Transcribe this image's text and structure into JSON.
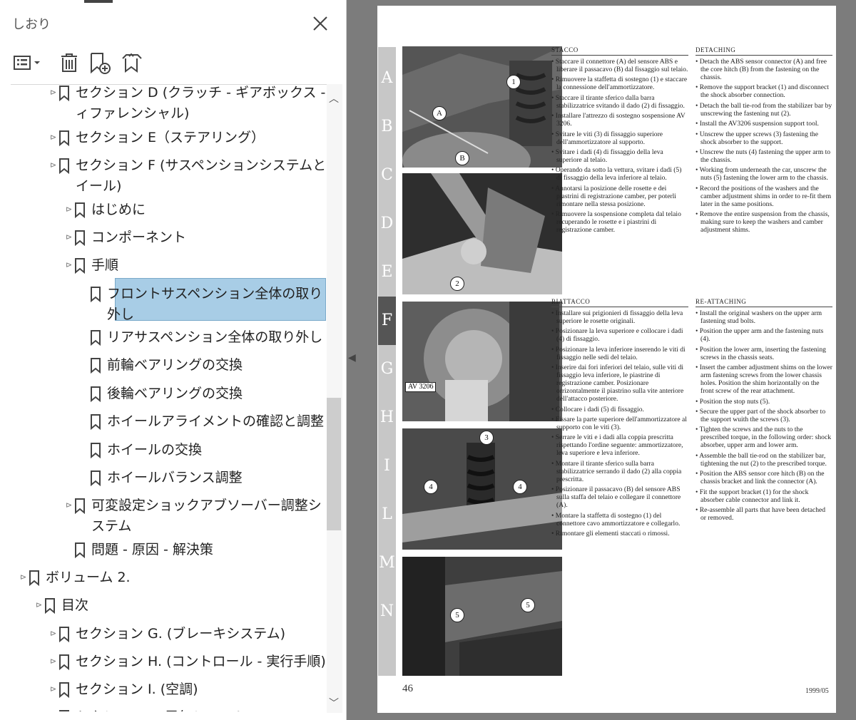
{
  "panel": {
    "title": "しおり",
    "toolbar": {
      "options": "options-icon",
      "delete": "trash-icon",
      "add": "add-bookmark-icon",
      "expand": "expand-bookmark-icon"
    }
  },
  "bookmarks": [
    {
      "label": "セクション D (クラッチ - ギアボックス - デ",
      "label2": "ィファレンシャル)"
    },
    {
      "label": "セクション E（ステアリング）"
    },
    {
      "label": "セクション F (サスペンションシステムとホ",
      "label2": "イール)"
    },
    {
      "label": "はじめに"
    },
    {
      "label": "コンポーネント"
    },
    {
      "label": "手順"
    },
    {
      "label": "フロントサスペンション全体の取り",
      "label2": "外し"
    },
    {
      "label": "リアサスペンション全体の取り外し"
    },
    {
      "label": "前輪ベアリングの交換"
    },
    {
      "label": "後輪ベアリングの交換"
    },
    {
      "label": "ホイールアライメントの確認と調整"
    },
    {
      "label": "ホイールの交換"
    },
    {
      "label": "ホイールバランス調整"
    },
    {
      "label": "可変設定ショックアブソーバー調整シ",
      "label2": "ステム"
    },
    {
      "label": "問題 - 原因 - 解決策"
    },
    {
      "label": "ボリューム 2."
    },
    {
      "label": "目次"
    },
    {
      "label": "セクション G. (ブレーキシステム)"
    },
    {
      "label": "セクション H. (コントロール - 実行手順)"
    },
    {
      "label": "セクション I. (空調)"
    },
    {
      "label": "セクション L (電気システム)"
    }
  ],
  "doc": {
    "tabs": [
      "A",
      "B",
      "C",
      "D",
      "E",
      "F",
      "G",
      "H",
      "I",
      "L",
      "M",
      "N"
    ],
    "active_tab": "F",
    "page_number": "46",
    "date": "1999/05",
    "fig_caption": "AV 3206",
    "it_detach_title": "Stacco",
    "it_detach": [
      "Staccare il connettore (A) del sensore ABS e liberare il passacavo (B) dal fissaggio sul telaio.",
      "Rimuovere la staffetta di sostegno (1) e staccare la connessione dell'ammortizzatore.",
      "Staccare il tirante sferico dalla barra stabilizzatrice svitando il dado (2) di fissaggio.",
      "Installare l'attrezzo di sostegno sospensione AV 3206.",
      "Svitare le viti (3) di fissaggio superiore dell'ammortizzatore al supporto.",
      "Svitare i dadi (4) di fissaggio della leva superiore al telaio.",
      "Operando da sotto la vettura, svitare i dadi (5) di fissaggio della leva inferiore al telaio.",
      "Annotarsi la posizione delle rosette e dei piastrini di registrazione camber, per poterli rimontare nella stessa posizione.",
      "Rimuovere la sospensione completa dal telaio recuperando le rosette e i piastrini di registrazione camber."
    ],
    "en_detach_title": "Detaching",
    "en_detach": [
      "Detach the ABS sensor connector (A) and free the core hitch (B) from the fastening on the chassis.",
      "Remove the support bracket (1) and disconnect the shock absorber connection.",
      "Detach the ball tie-rod from the stabilizer bar by unscrewing the fastening nut (2).",
      "Install the AV3206 suspension support tool.",
      "Unscrew the upper screws (3) fastening the shock absorber to the support.",
      "Unscrew the nuts (4) fastening the upper arm to the chassis.",
      "Working from underneath the car, unscrew the nuts (5) fastening the lower arm to the chassis.",
      "Record the positions of the washers and the camber adjustment shims in order to re-fit them later in the same positions.",
      "Remove the entire suspension from the chassis, making sure to keep the washers and camber adjustment shims."
    ],
    "it_attach_title": "Riattacco",
    "it_attach": [
      "Installare sui prigionieri di fissaggio della leva superiore le rosette originali.",
      "Posizionare la leva superiore e collocare i dadi (4) di fissaggio.",
      "Posizionare la leva inferiore inserendo le viti di fissaggio nelle sedi del telaio.",
      "Inserire dai fori inferiori del telaio, sulle viti di fissaggio leva inferiore, le piastrine di registrazione camber. Posizionare orrizontalmente il piastrino sulla vite anteriore dell'attacco posteriore.",
      "Collocare i dadi (5) di fissaggio.",
      "Fissare la parte superiore dell'ammortizzatore al supporto con le viti (3).",
      "Serrare le viti e i dadi alla coppia prescritta rispettando l'ordine seguente: ammortizzatore, leva superiore e leva inferiore.",
      "Montare il tirante sferico sulla barra stabilizzatrice serrando il dado (2) alla coppia prescritta.",
      "Posizionare il passacavo (B) del sensore ABS sulla staffa del telaio e collegare il connettore (A).",
      "Montare la staffetta di sostegno (1) del connettore cavo ammortizzatore e collegarlo.",
      "Rimontare gli elementi staccati o rimossi."
    ],
    "en_attach_title": "Re-attaching",
    "en_attach": [
      "Install the original washers on the upper arm fastening stud bolts.",
      "Position the upper arm and the fastening nuts (4).",
      "Position the lower arm, inserting the fastening screws in the chassis seats.",
      "Insert the camber adjustment shims on the lower arm fastening screws from the lower chassis holes. Position the shim horizontally on the front screw of the rear attachment.",
      "Position the stop nuts (5).",
      "Secure the upper part of the shock absorber to the support wuith the screws (3).",
      "Tighten the screws and the nuts to the prescribed torque, in the following order: shock absorber, upper arm and lower arm.",
      "Assemble the ball tie-rod on the stabilizer bar, tightening the nut (2) to the prescribed torque.",
      "Position the ABS sensor core hitch (B) on the chassis bracket and link the connector (A).",
      "Fit the support bracket (1) for the shock absorber cable connector and link it.",
      "Re-assemble all parts that have been detached or removed."
    ]
  }
}
